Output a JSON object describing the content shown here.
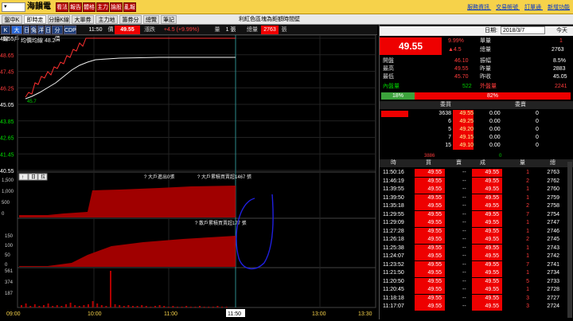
{
  "toolbar": {
    "stock_select": "",
    "stock_name": "海韻電",
    "buttons": [
      "看法",
      "報告",
      "體格",
      "主力",
      "論股",
      "亂報"
    ],
    "links": [
      "服務資訊",
      "交易帳號",
      "訂單通",
      "新增功能"
    ]
  },
  "tabs": {
    "items": [
      "盤中K線",
      "即時走勢",
      "分鐘K線",
      "大單券商",
      "主力地圖",
      "籌券分析",
      "總覽",
      "筆記"
    ],
    "active": 1,
    "notice": "利紅色區塊為鉅額時間壁"
  },
  "infobar": {
    "period_buttons": [
      "K線",
      "大戶",
      "日",
      "兔",
      "洋",
      "日",
      "分價",
      "CDP"
    ],
    "time": "11:50",
    "price_label": "價",
    "price": "49.55",
    "change_label": "漲跌",
    "change": "+4.5 (+9.99%)",
    "volume_label": "量",
    "volume": "1 張",
    "total_label": "總量",
    "total": "2763",
    "total_unit": "張"
  },
  "price_chart": {
    "legend": "均價均線 48.2",
    "low_label": "45.7",
    "y_labels": [
      "49.55",
      "48.65",
      "47.45",
      "46.25",
      "45.05",
      "43.85",
      "42.65",
      "41.45",
      "40.55"
    ],
    "y_colors": [
      "#fff",
      "#ff3c3c",
      "#ff3c3c",
      "#ff3c3c",
      "#fff",
      "#00e000",
      "#00e000",
      "#00e000",
      "#fff"
    ],
    "indicator_tabs": [
      "↑",
      "日",
      "拉"
    ],
    "big_label_a": "大戶進出0張",
    "big_label_b": "大戶累積買賣超1467 張",
    "small_label": "散戶累積買賣超177 張",
    "big_y_labels": [
      "1,500",
      "1,000",
      "500",
      "0"
    ],
    "small_y_labels": [
      "150",
      "100",
      "50",
      "0"
    ],
    "vol_y_labels": [
      "561",
      "374",
      "187"
    ],
    "x_labels": [
      "09:00",
      "10:00",
      "11:00",
      "11:50",
      "13:00",
      "13:30"
    ]
  },
  "quote": {
    "date_label": "日期:",
    "date": "2018/3/7",
    "today_btn": "今天",
    "big_price": "49.55",
    "pct": "9.99%",
    "change": "▲4.5",
    "fields": [
      {
        "l": "開盤",
        "v": "46.10",
        "l2": "振幅",
        "v2": "8.5%"
      },
      {
        "l": "最高",
        "v": "49.55",
        "l2": "昨量",
        "v2": "2883"
      },
      {
        "l": "最低",
        "v": "45.70",
        "l2": "昨收",
        "v2": "45.05"
      }
    ],
    "unit_label": "單量",
    "unit_val": "1",
    "total_label": "總量",
    "total_val": "2763",
    "inner_label": "內盤量",
    "inner_val": "522",
    "outer_label": "外盤量",
    "outer_val": "2241",
    "pct_green": "18%",
    "pct_red": "82%",
    "buy_header": "委買",
    "sell_header": "委賣",
    "book": [
      {
        "bq": "3638",
        "bp": "49.55",
        "sp": "0.00",
        "sq": "0"
      },
      {
        "bq": "6",
        "bp": "49.25",
        "sp": "0.00",
        "sq": "0"
      },
      {
        "bq": "5",
        "bp": "49.20",
        "sp": "0.00",
        "sq": "0"
      },
      {
        "bq": "7",
        "bp": "49.15",
        "sp": "0.00",
        "sq": "0"
      },
      {
        "bq": "15",
        "bp": "49.10",
        "sp": "0.00",
        "sq": "0"
      }
    ],
    "book_totals": {
      "b": "3886",
      "s": "0"
    },
    "tick_headers": [
      "時",
      "買",
      "賣",
      "成",
      "量",
      "總"
    ],
    "ticks": [
      {
        "t": "11:50:16",
        "b": "49.55",
        "s": "--",
        "p": "49.55",
        "q": "1",
        "v": "2763"
      },
      {
        "t": "11:46:19",
        "b": "49.55",
        "s": "--",
        "p": "49.55",
        "q": "2",
        "v": "2762"
      },
      {
        "t": "11:39:55",
        "b": "49.55",
        "s": "--",
        "p": "49.55",
        "q": "1",
        "v": "2760"
      },
      {
        "t": "11:39:50",
        "b": "49.55",
        "s": "--",
        "p": "49.55",
        "q": "1",
        "v": "2759"
      },
      {
        "t": "11:35:18",
        "b": "49.55",
        "s": "--",
        "p": "49.55",
        "q": "2",
        "v": "2758"
      },
      {
        "t": "11:29:55",
        "b": "49.55",
        "s": "--",
        "p": "49.55",
        "q": "7",
        "v": "2754"
      },
      {
        "t": "11:29:09",
        "b": "49.55",
        "s": "--",
        "p": "49.55",
        "q": "1",
        "v": "2747"
      },
      {
        "t": "11:27:28",
        "b": "49.55",
        "s": "--",
        "p": "49.55",
        "q": "1",
        "v": "2746"
      },
      {
        "t": "11:26:18",
        "b": "49.55",
        "s": "--",
        "p": "49.55",
        "q": "2",
        "v": "2745"
      },
      {
        "t": "11:25:38",
        "b": "49.55",
        "s": "--",
        "p": "49.55",
        "q": "1",
        "v": "2743"
      },
      {
        "t": "11:24:07",
        "b": "49.55",
        "s": "--",
        "p": "49.55",
        "q": "1",
        "v": "2742"
      },
      {
        "t": "11:23:52",
        "b": "49.55",
        "s": "--",
        "p": "49.55",
        "q": "7",
        "v": "2741"
      },
      {
        "t": "11:21:50",
        "b": "49.55",
        "s": "--",
        "p": "49.55",
        "q": "1",
        "v": "2734"
      },
      {
        "t": "11:20:50",
        "b": "49.55",
        "s": "--",
        "p": "49.55",
        "q": "5",
        "v": "2733"
      },
      {
        "t": "11:20:45",
        "b": "49.55",
        "s": "--",
        "p": "49.55",
        "q": "1",
        "v": "2728"
      },
      {
        "t": "11:18:18",
        "b": "49.55",
        "s": "--",
        "p": "49.55",
        "q": "3",
        "v": "2727"
      },
      {
        "t": "11:17:07",
        "b": "49.55",
        "s": "--",
        "p": "49.55",
        "q": "3",
        "v": "2724"
      }
    ]
  },
  "colors": {
    "up": "#ff2020",
    "down": "#00d000",
    "panel": "#000",
    "accent": "#f6d24a"
  }
}
